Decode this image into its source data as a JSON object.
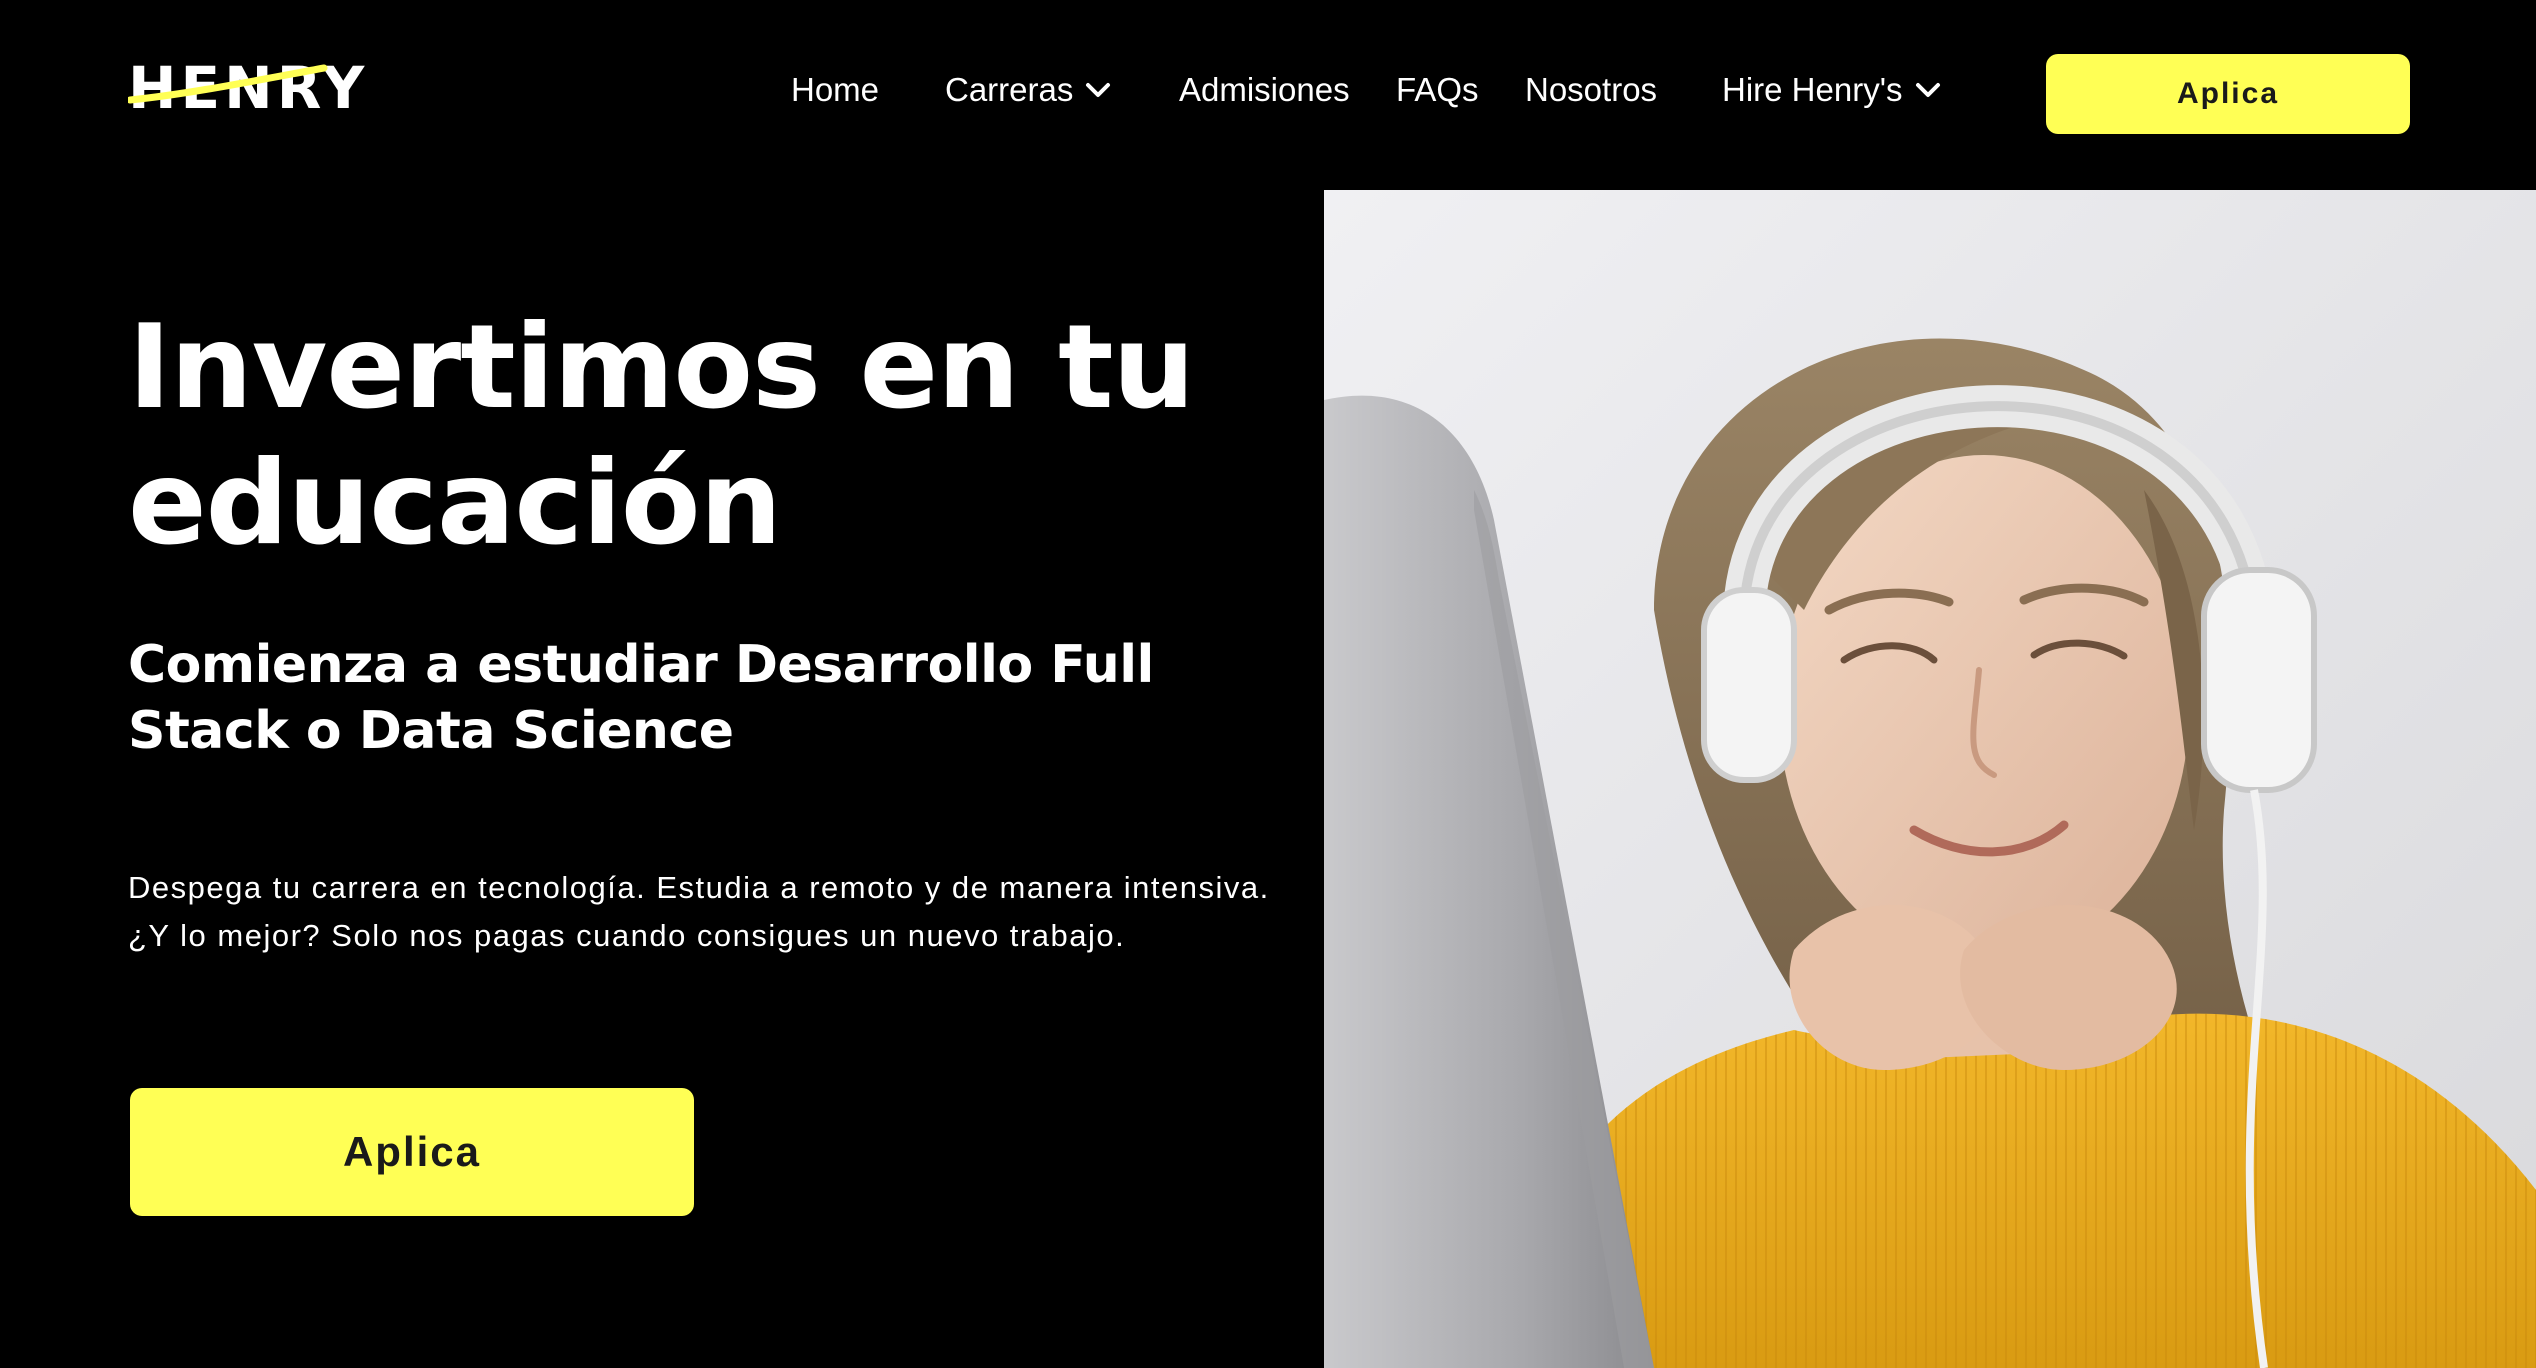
{
  "brand": {
    "logo_text": "HENRY",
    "accent_color": "#ffff55",
    "background_color": "#000000"
  },
  "nav": {
    "items": [
      {
        "label": "Home",
        "has_dropdown": false
      },
      {
        "label": "Carreras",
        "has_dropdown": true
      },
      {
        "label": "Admisiones",
        "has_dropdown": false
      },
      {
        "label": "FAQs",
        "has_dropdown": false
      },
      {
        "label": "Nosotros",
        "has_dropdown": false
      },
      {
        "label": "Hire Henry's",
        "has_dropdown": true
      }
    ],
    "cta_label": "Aplica",
    "dropdown_icon": "chevron-down-icon"
  },
  "hero": {
    "title": "Invertimos en tu educación",
    "subtitle": "Comienza a estudiar Desarrollo Full Stack o Data Science",
    "description": "Despega tu carrera en tecnología. Estudia a remoto y de manera intensiva. ¿Y lo mejor? Solo nos pagas cuando consigues un nuevo trabajo.",
    "cta_label": "Aplica",
    "image_subject": "student-with-headphones-at-computer"
  }
}
